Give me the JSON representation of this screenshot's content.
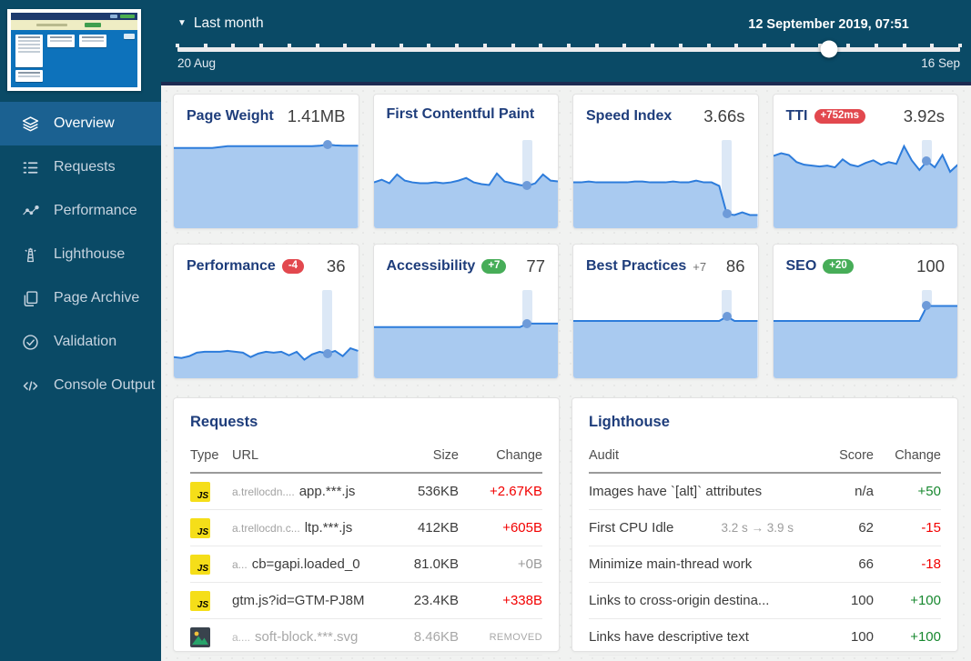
{
  "sidebar": {
    "items": [
      {
        "label": "Overview",
        "icon": "layers-icon",
        "active": true
      },
      {
        "label": "Requests",
        "icon": "list-icon",
        "active": false
      },
      {
        "label": "Performance",
        "icon": "scatter-chart-icon",
        "active": false
      },
      {
        "label": "Lighthouse",
        "icon": "lighthouse-icon",
        "active": false
      },
      {
        "label": "Page Archive",
        "icon": "pages-icon",
        "active": false
      },
      {
        "label": "Validation",
        "icon": "check-circle-icon",
        "active": false
      },
      {
        "label": "Console Output",
        "icon": "code-icon",
        "active": false
      }
    ]
  },
  "topbar": {
    "range_label": "Last month",
    "start_label": "20 Aug",
    "end_label": "16 Sep",
    "current_label": "12 September 2019, 07:51",
    "slider_pct": 83.2,
    "tick_count": 29
  },
  "cards": [
    {
      "title": "Page Weight",
      "value": "1.41MB",
      "highlight": false,
      "marker": 20,
      "series": [
        91,
        91,
        91,
        91,
        91,
        91,
        92,
        93,
        93,
        93,
        93,
        93,
        93,
        93,
        93,
        93,
        93,
        93,
        93,
        93.5,
        95,
        94,
        93.5,
        93.5,
        93.5
      ]
    },
    {
      "title": "First Contentful Paint",
      "value": "",
      "highlight": true,
      "marker": 20,
      "series": [
        52,
        55,
        51,
        61,
        54,
        52,
        51,
        51,
        52,
        51,
        52,
        54,
        57,
        52,
        50,
        49,
        62,
        53,
        51,
        49,
        48,
        51,
        61,
        54,
        53
      ]
    },
    {
      "title": "Speed Index",
      "value": "3.66s",
      "highlight": true,
      "marker": 20,
      "series": [
        52,
        52,
        53,
        52,
        52,
        52,
        52,
        52,
        53,
        53,
        52,
        52,
        52,
        53,
        52,
        52,
        54,
        52,
        52,
        48,
        16,
        15,
        18,
        15,
        15
      ]
    },
    {
      "title": "TTI",
      "value": "3.92s",
      "badge": {
        "text": "+752ms",
        "style": "pill-red"
      },
      "highlight": true,
      "marker": 20,
      "series": [
        82,
        85,
        83,
        75,
        72,
        71,
        70,
        71,
        69,
        78,
        72,
        70,
        74,
        77,
        72,
        75,
        73,
        93,
        77,
        66,
        76,
        69,
        83,
        64,
        72
      ]
    },
    {
      "title": "Performance",
      "value": "36",
      "badge": {
        "text": "-4",
        "style": "pill-red"
      },
      "highlight": true,
      "marker": 20,
      "series": [
        24,
        23,
        25,
        29,
        30,
        30,
        30,
        31,
        30,
        29,
        24,
        28,
        30,
        29,
        30,
        26,
        30,
        21,
        27,
        30,
        28,
        31,
        25,
        34,
        31
      ]
    },
    {
      "title": "Accessibility",
      "value": "77",
      "badge": {
        "text": "+7",
        "style": "pill-green"
      },
      "highlight": true,
      "marker": 20,
      "series": [
        58,
        58,
        58,
        58,
        58,
        58,
        58,
        58,
        58,
        58,
        58,
        58,
        58,
        58,
        58,
        58,
        58,
        58,
        58,
        58,
        62,
        62,
        62,
        62,
        62
      ]
    },
    {
      "title": "Best Practices",
      "value": "86",
      "note": "+7",
      "highlight": true,
      "marker": 20,
      "series": [
        65,
        65,
        65,
        65,
        65,
        65,
        65,
        65,
        65,
        65,
        65,
        65,
        65,
        65,
        65,
        65,
        65,
        65,
        65,
        65,
        70,
        65,
        65,
        65,
        65
      ]
    },
    {
      "title": "SEO",
      "value": "100",
      "badge": {
        "text": "+20",
        "style": "pill-green"
      },
      "highlight": true,
      "marker": 20,
      "series": [
        65,
        65,
        65,
        65,
        65,
        65,
        65,
        65,
        65,
        65,
        65,
        65,
        65,
        65,
        65,
        65,
        65,
        65,
        65,
        65,
        82,
        82,
        82,
        82,
        82
      ]
    }
  ],
  "requests": {
    "title": "Requests",
    "columns": [
      "Type",
      "URL",
      "Size",
      "Change"
    ],
    "rows": [
      {
        "type": "js",
        "url_prefix": "a.trellocdn....",
        "url_main": "app.***.js",
        "size": "536KB",
        "change": "+2.67KB",
        "change_color": "red",
        "removed": false
      },
      {
        "type": "js",
        "url_prefix": "a.trellocdn.c...",
        "url_main": "ltp.***.js",
        "size": "412KB",
        "change": "+605B",
        "change_color": "red",
        "removed": false
      },
      {
        "type": "js",
        "url_prefix": "a...",
        "url_main": "cb=gapi.loaded_0",
        "size": "81.0KB",
        "change": "+0B",
        "change_color": "gray",
        "removed": false
      },
      {
        "type": "js",
        "url_prefix": "",
        "url_main": "gtm.js?id=GTM-PJ8M",
        "size": "23.4KB",
        "change": "+338B",
        "change_color": "red",
        "removed": false
      },
      {
        "type": "img",
        "url_prefix": "a....",
        "url_main": "soft-block.***.svg",
        "size": "8.46KB",
        "change": "REMOVED",
        "change_color": "removed",
        "removed": true
      }
    ]
  },
  "lighthouse": {
    "title": "Lighthouse",
    "columns": [
      "Audit",
      "Score",
      "Change"
    ],
    "rows": [
      {
        "audit": "Images have `[alt]` attributes",
        "detail": "",
        "score": "n/a",
        "change": "+50",
        "change_color": "green"
      },
      {
        "audit": "First CPU Idle",
        "detail": "3.2 s → 3.9 s",
        "score": "62",
        "change": "-15",
        "change_color": "red"
      },
      {
        "audit": "Minimize main-thread work",
        "detail": "",
        "score": "66",
        "change": "-18",
        "change_color": "red"
      },
      {
        "audit": "Links to cross-origin destina...",
        "detail": "",
        "score": "100",
        "change": "+100",
        "change_color": "green"
      },
      {
        "audit": "Links have descriptive text",
        "detail": "",
        "score": "100",
        "change": "+100",
        "change_color": "green"
      }
    ]
  },
  "colors": {
    "line": "#2d7cdb",
    "fill": "#a9caf0",
    "dot": "#6e9bd9",
    "highlight": "#dce8f6",
    "sidebar": "#0a4a66",
    "sidebar_active": "#1b6191",
    "title_navy": "#1e3d7b",
    "badge_red": "#e2484e",
    "badge_green": "#47ad58",
    "change_red": "#f20000",
    "change_green": "#17882f"
  }
}
